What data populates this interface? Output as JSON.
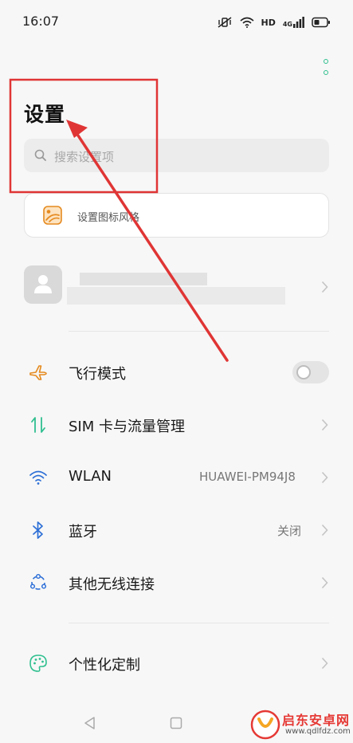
{
  "status_bar": {
    "time": "16:07",
    "hd_label": "HD",
    "network_label": "4G",
    "icons": [
      "mute-vibrate-icon",
      "wifi-icon",
      "signal-icon",
      "battery-icon"
    ]
  },
  "header": {
    "title": "设置",
    "menu_icon": "more-vertical-icon"
  },
  "search": {
    "placeholder": "搜索设置项"
  },
  "tip_card": {
    "text": "设置图标风格",
    "icon": "icon-style-icon"
  },
  "settings": [
    {
      "label": "飞行模式",
      "icon": "airplane-icon",
      "control": "toggle",
      "toggle_on": false
    },
    {
      "label": "SIM 卡与流量管理",
      "icon": "sim-data-icon",
      "control": "chevron"
    },
    {
      "label": "WLAN",
      "value": "HUAWEI-PM94J8",
      "icon": "wifi-icon",
      "control": "chevron"
    },
    {
      "label": "蓝牙",
      "value": "关闭",
      "icon": "bluetooth-icon",
      "control": "chevron"
    },
    {
      "label": "其他无线连接",
      "icon": "wireless-connections-icon",
      "control": "chevron"
    },
    {
      "label": "个性化定制",
      "icon": "palette-icon",
      "control": "chevron"
    }
  ],
  "watermark": {
    "title": "启东安卓网",
    "url": "www.qdlfdz.com"
  },
  "colors": {
    "accent": "#2fbf8f",
    "annotation_red": "#e03535",
    "background": "#f7f7f7"
  }
}
